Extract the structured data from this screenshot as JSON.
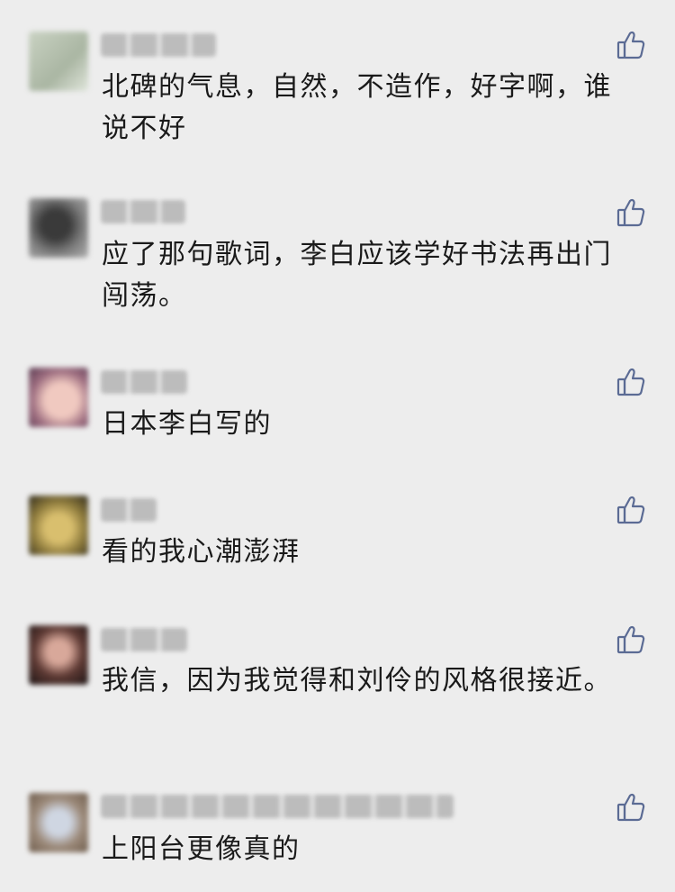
{
  "comments": [
    {
      "text": "北碑的气息，自然，不造作，好字啊，谁说不好",
      "like_icon": "thumbs-up-icon"
    },
    {
      "text": "应了那句歌词，李白应该学好书法再出门闯荡。",
      "like_icon": "thumbs-up-icon"
    },
    {
      "text": "日本李白写的",
      "like_icon": "thumbs-up-icon"
    },
    {
      "text": "看的我心潮澎湃",
      "like_icon": "thumbs-up-icon"
    },
    {
      "text": "我信，因为我觉得和刘伶的风格很接近。",
      "like_icon": "thumbs-up-icon"
    },
    {
      "text": "上阳台更像真的",
      "like_icon": "thumbs-up-icon"
    }
  ],
  "colors": {
    "background": "#ededed",
    "text": "#1a1a1a",
    "like_icon": "#5b6b94"
  }
}
